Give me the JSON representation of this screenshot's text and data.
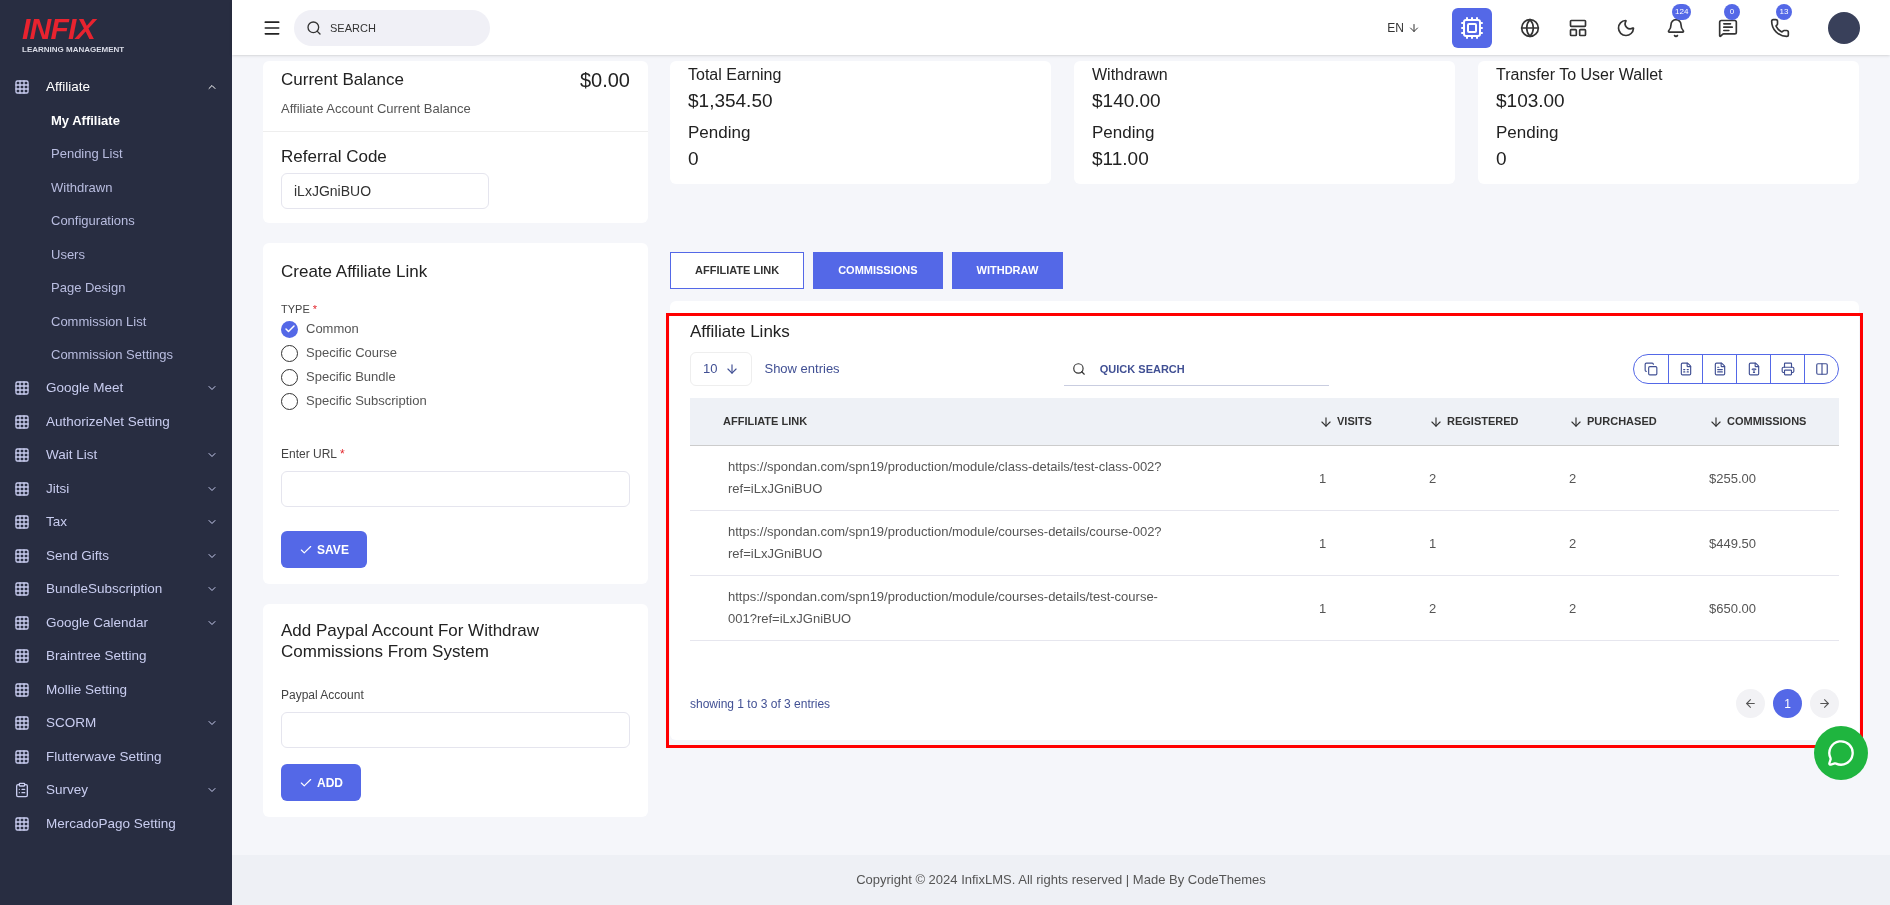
{
  "brand": {
    "logo": "INFIX",
    "tagline": "LEARNING MANAGEMENT"
  },
  "sidebar": {
    "items": [
      {
        "label": "Affiliate",
        "kind": "grid",
        "expanded": true,
        "children": [
          {
            "label": "My Affiliate",
            "selected": true
          },
          {
            "label": "Pending List",
            "selected": false
          },
          {
            "label": "Withdrawn",
            "selected": false
          },
          {
            "label": "Configurations",
            "selected": false
          },
          {
            "label": "Users",
            "selected": false
          },
          {
            "label": "Page Design",
            "selected": false
          },
          {
            "label": "Commission List",
            "selected": false
          },
          {
            "label": "Commission Settings",
            "selected": false
          }
        ]
      },
      {
        "label": "Google Meet",
        "kind": "grid",
        "expanded": false
      },
      {
        "label": "AuthorizeNet Setting",
        "kind": "grid"
      },
      {
        "label": "Wait List",
        "kind": "grid",
        "expanded": false
      },
      {
        "label": "Jitsi",
        "kind": "grid",
        "expanded": false
      },
      {
        "label": "Tax",
        "kind": "grid",
        "expanded": false
      },
      {
        "label": "Send Gifts",
        "kind": "grid",
        "expanded": false
      },
      {
        "label": "BundleSubscription",
        "kind": "grid",
        "expanded": false
      },
      {
        "label": "Google Calendar",
        "kind": "grid",
        "expanded": false
      },
      {
        "label": "Braintree Setting",
        "kind": "grid"
      },
      {
        "label": "Mollie Setting",
        "kind": "grid"
      },
      {
        "label": "SCORM",
        "kind": "grid",
        "expanded": false
      },
      {
        "label": "Flutterwave Setting",
        "kind": "grid"
      },
      {
        "label": "Survey",
        "kind": "form",
        "expanded": false
      },
      {
        "label": "MercadoPago Setting",
        "kind": "grid"
      }
    ]
  },
  "header": {
    "search_placeholder": "SEARCH",
    "language": "EN",
    "badges": [
      {
        "kind": "bell",
        "count": "124"
      },
      {
        "kind": "chat",
        "count": "0"
      },
      {
        "kind": "whatsapp",
        "count": "13"
      }
    ]
  },
  "balance_card": {
    "title": "Current Balance",
    "amount": "$0.00",
    "subtitle": "Affiliate Account Current Balance"
  },
  "referral": {
    "title": "Referral Code",
    "value": "iLxJGniBUO"
  },
  "stat_cards": [
    {
      "title": "Total Earning",
      "amount": "$1,354.50",
      "pending_label": "Pending",
      "pending": "0"
    },
    {
      "title": "Withdrawn",
      "amount": "$140.00",
      "pending_label": "Pending",
      "pending": "$11.00"
    },
    {
      "title": "Transfer To User Wallet",
      "amount": "$103.00",
      "pending_label": "Pending",
      "pending": "0"
    }
  ],
  "create_link": {
    "title": "Create Affiliate Link",
    "type_label": "TYPE",
    "required_mark": "*",
    "options": [
      {
        "label": "Common",
        "selected": true
      },
      {
        "label": "Specific Course",
        "selected": false
      },
      {
        "label": "Specific Bundle",
        "selected": false
      },
      {
        "label": "Specific Subscription",
        "selected": false
      }
    ],
    "url_label": "Enter URL",
    "button": "SAVE"
  },
  "paypal": {
    "title": "Add Paypal Account For Withdraw Commissions From System",
    "field_label": "Paypal Account",
    "button": "ADD"
  },
  "tabs": [
    {
      "label": "AFFILIATE LINK",
      "selected": true
    },
    {
      "label": "COMMISSIONS",
      "selected": false
    },
    {
      "label": "WITHDRAW",
      "selected": false
    }
  ],
  "table": {
    "title": "Affiliate Links",
    "page_size": "10",
    "show_entries": "Show entries",
    "search_placeholder": "QUICK SEARCH",
    "columns": [
      {
        "label": "AFFILIATE LINK",
        "sortable": false
      },
      {
        "label": "VISITS",
        "sortable": true
      },
      {
        "label": "REGISTERED",
        "sortable": true
      },
      {
        "label": "PURCHASED",
        "sortable": true
      },
      {
        "label": "COMMISSIONS",
        "sortable": true
      }
    ],
    "rows": [
      [
        "https://spondan.com/spn19/production/module/class-details/test-class-002?ref=iLxJGniBUO",
        "1",
        "2",
        "2",
        "$255.00"
      ],
      [
        "https://spondan.com/spn19/production/module/courses-details/course-002?ref=iLxJGniBUO",
        "1",
        "1",
        "2",
        "$449.50"
      ],
      [
        "https://spondan.com/spn19/production/module/courses-details/test-course-001?ref=iLxJGniBUO",
        "1",
        "2",
        "2",
        "$650.00"
      ]
    ],
    "info": "showing 1 to 3 of 3 entries",
    "pages": [
      {
        "label": "1",
        "selected": true
      }
    ]
  },
  "footer": "Copyright © 2024 InfixLMS. All rights reserved | Made By CodeThemes"
}
